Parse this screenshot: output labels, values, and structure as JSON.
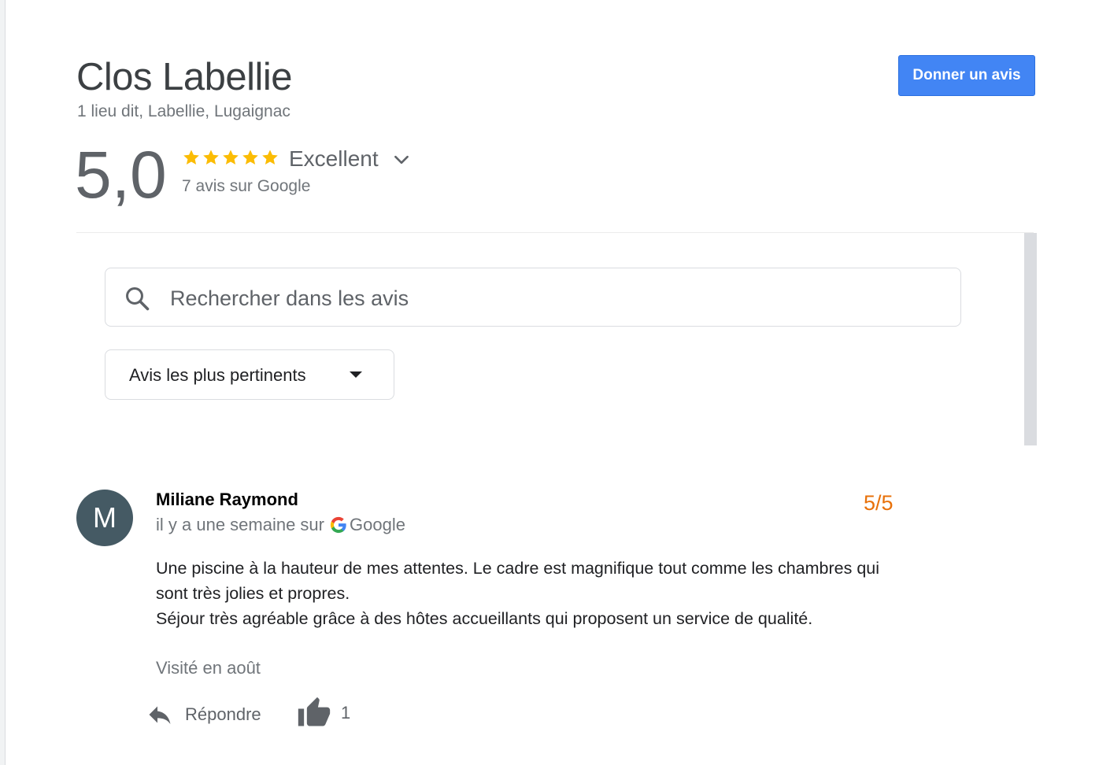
{
  "place": {
    "name": "Clos Labellie",
    "address": "1 lieu dit, Labellie, Lugaignac"
  },
  "actions": {
    "write_review_label": "Donner un avis"
  },
  "rating": {
    "score": "5,0",
    "stars": 5,
    "label": "Excellent",
    "count_text": "7 avis sur Google",
    "star_color": "#fbbc04"
  },
  "search": {
    "placeholder": "Rechercher dans les avis",
    "value": ""
  },
  "sort": {
    "selected": "Avis les plus pertinents"
  },
  "review": {
    "avatar_letter": "M",
    "avatar_color": "#455a64",
    "author": "Miliane Raymond",
    "time_prefix": "il y a une semaine sur",
    "source": "Google",
    "score": "5/5",
    "score_color": "#e8710a",
    "text_lines": [
      "Une piscine à la hauteur de mes attentes. Le cadre est magnifique tout comme les chambres qui sont très jolies et propres.",
      "Séjour très agréable grâce à des hôtes accueillants qui proposent un service de qualité."
    ],
    "visited": "Visité en août",
    "reply_label": "Répondre",
    "likes": "1"
  },
  "colors": {
    "accent_button": "#4285f4",
    "score_text": "#5f6368",
    "muted_text": "#70757a"
  },
  "icons": {
    "search": "search-icon",
    "chevron": "chevron-down-icon",
    "google": "google-g-icon",
    "reply": "reply-arrow-icon",
    "like": "thumbs-up-icon"
  }
}
